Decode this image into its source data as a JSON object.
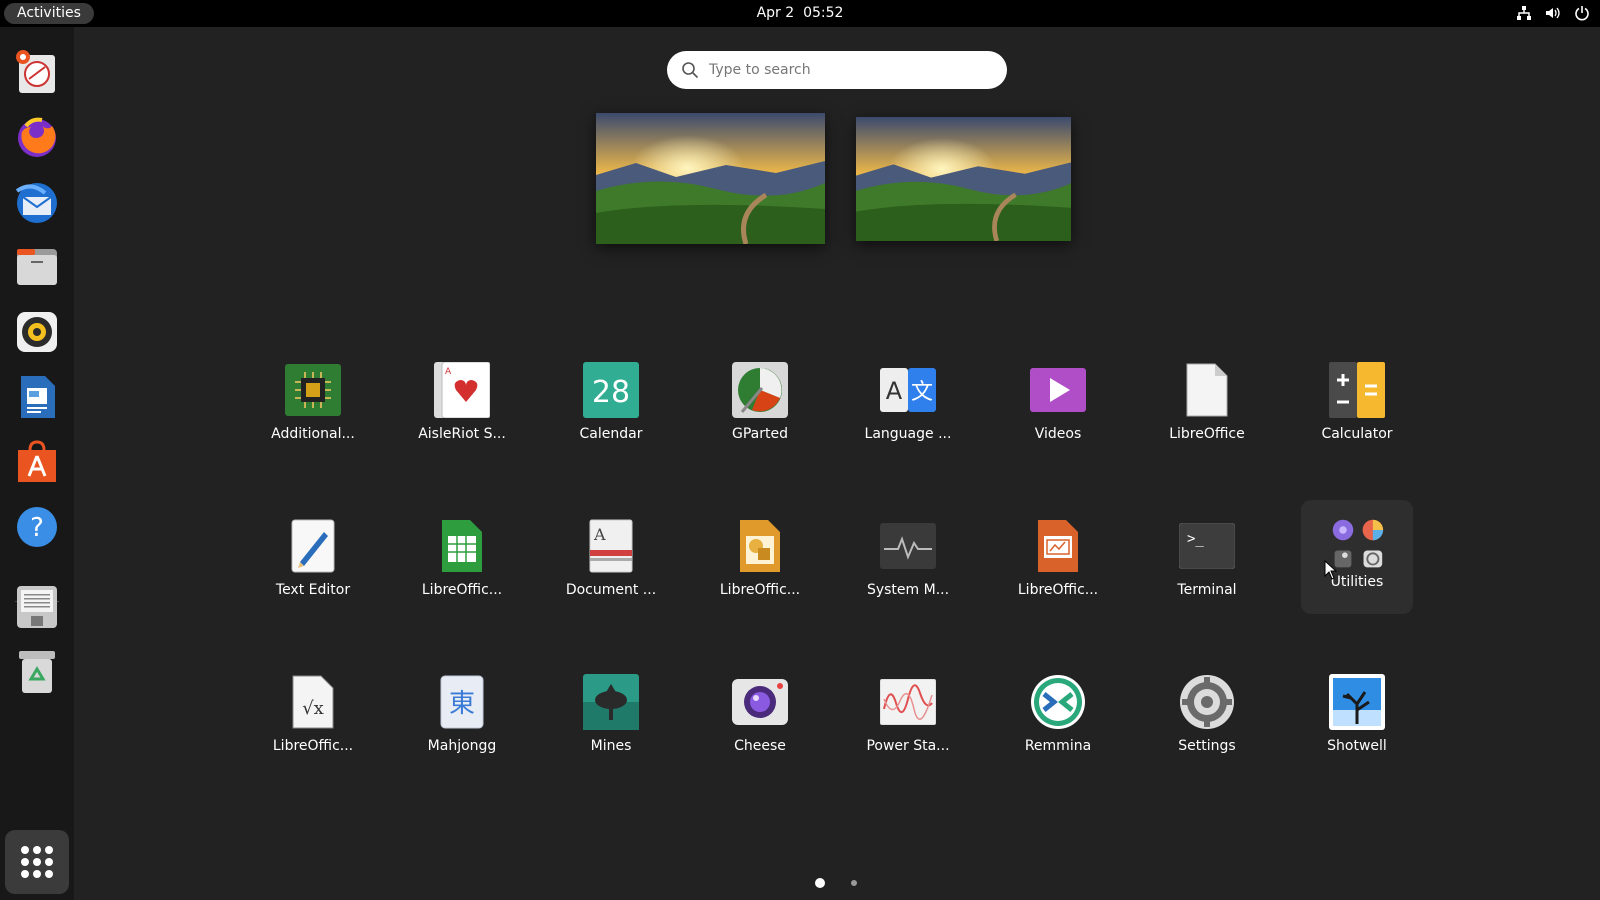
{
  "topbar": {
    "activities_label": "Activities",
    "date": "Apr 2",
    "time": "05:52",
    "tray_icons": [
      "network-icon",
      "volume-icon",
      "power-icon"
    ]
  },
  "search": {
    "placeholder": "Type to search",
    "value": ""
  },
  "dock": {
    "items": [
      {
        "name": "ubuntu-installer",
        "icon": "installer-icon"
      },
      {
        "name": "firefox",
        "icon": "firefox-icon"
      },
      {
        "name": "thunderbird",
        "icon": "thunderbird-icon"
      },
      {
        "name": "files",
        "icon": "files-icon"
      },
      {
        "name": "rhythmbox",
        "icon": "rhythmbox-icon"
      },
      {
        "name": "libreoffice-writer",
        "icon": "writer-icon"
      },
      {
        "name": "software",
        "icon": "software-icon"
      },
      {
        "name": "help",
        "icon": "help-icon"
      },
      {
        "name": "disk",
        "icon": "disk-icon"
      },
      {
        "name": "trash",
        "icon": "trash-icon"
      }
    ],
    "show_apps_icon": "app-grid-icon"
  },
  "apps": {
    "row1": [
      {
        "label": "Additional...",
        "icon": "chip-icon"
      },
      {
        "label": "AisleRiot S...",
        "icon": "cards-icon"
      },
      {
        "label": "Calendar",
        "icon": "calendar-icon",
        "day": "28"
      },
      {
        "label": "GParted",
        "icon": "gparted-icon"
      },
      {
        "label": "Language ...",
        "icon": "language-icon"
      },
      {
        "label": "Videos",
        "icon": "videos-icon"
      },
      {
        "label": "LibreOffice",
        "icon": "libreoffice-icon"
      },
      {
        "label": "Calculator",
        "icon": "calculator-icon"
      }
    ],
    "row2": [
      {
        "label": "Text Editor",
        "icon": "text-editor-icon"
      },
      {
        "label": "LibreOffic...",
        "icon": "calc-sheet-icon"
      },
      {
        "label": "Document ...",
        "icon": "document-viewer-icon"
      },
      {
        "label": "LibreOffic...",
        "icon": "draw-icon"
      },
      {
        "label": "System M...",
        "icon": "system-monitor-icon"
      },
      {
        "label": "LibreOffic...",
        "icon": "impress-icon"
      },
      {
        "label": "Terminal",
        "icon": "terminal-icon"
      },
      {
        "label": "Utilities",
        "icon": "utilities-folder-icon"
      }
    ],
    "row3": [
      {
        "label": "LibreOffic...",
        "icon": "math-icon"
      },
      {
        "label": "Mahjongg",
        "icon": "mahjongg-icon",
        "glyph": "東"
      },
      {
        "label": "Mines",
        "icon": "mines-icon"
      },
      {
        "label": "Cheese",
        "icon": "cheese-icon"
      },
      {
        "label": "Power Sta...",
        "icon": "power-stats-icon"
      },
      {
        "label": "Remmina",
        "icon": "remmina-icon"
      },
      {
        "label": "Settings",
        "icon": "settings-icon"
      },
      {
        "label": "Shotwell",
        "icon": "shotwell-icon"
      }
    ]
  },
  "pagination": {
    "pages": 2,
    "current": 1
  }
}
